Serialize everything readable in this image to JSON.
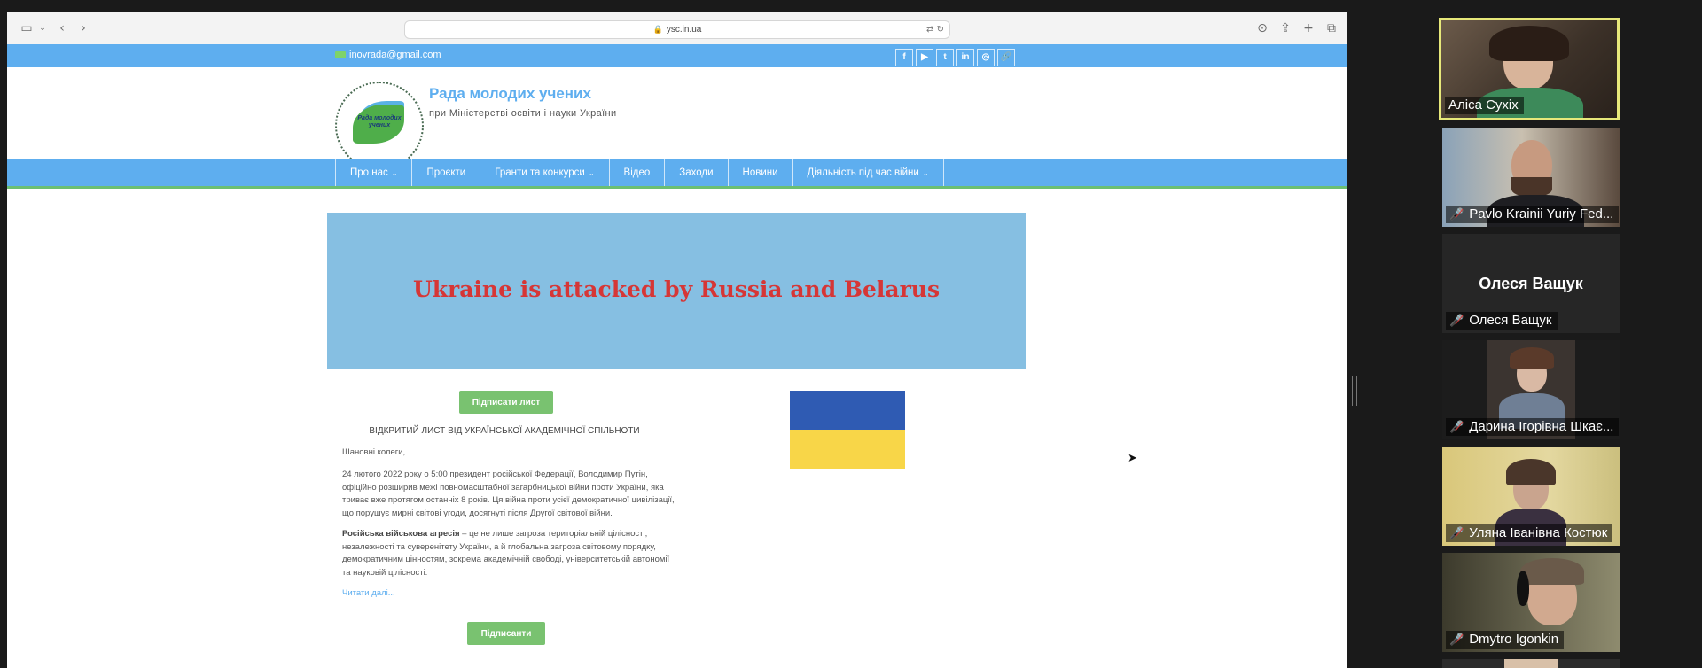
{
  "browser": {
    "url": "ysc.in.ua",
    "icons": [
      "sidebar-icon",
      "chevron-down-icon",
      "back-icon",
      "forward-icon",
      "download-icon",
      "share-icon",
      "new-tab-icon",
      "tabs-icon",
      "translate-icon",
      "reload-icon",
      "lock-icon"
    ]
  },
  "topbar": {
    "email": "inovrada@gmail.com",
    "social": [
      "f",
      "▶",
      "t",
      "in",
      "◎",
      "🔗"
    ]
  },
  "header": {
    "title": "Рада молодих учених",
    "subtitle": "при Міністерстві освіти і науки України",
    "logo_text": "Рада молодих учених"
  },
  "nav": {
    "items": [
      {
        "label": "Про нас",
        "dropdown": true
      },
      {
        "label": "Проєкти",
        "dropdown": false
      },
      {
        "label": "Гранти та конкурси",
        "dropdown": true
      },
      {
        "label": "Відео",
        "dropdown": false
      },
      {
        "label": "Заходи",
        "dropdown": false
      },
      {
        "label": "Новини",
        "dropdown": false
      },
      {
        "label": "Діяльність під час війни",
        "dropdown": true
      }
    ]
  },
  "banner": {
    "text": "Ukraine is attacked by Russia and Belarus"
  },
  "letter": {
    "sign_button": "Підписати лист",
    "title": "ВІДКРИТИЙ ЛИСТ ВІД УКРАЇНСЬКОЇ АКАДЕМІЧНОЇ СПІЛЬНОТИ",
    "greeting": "Шановні колеги,",
    "para1": "24 лютого 2022 року о 5:00 президент російської Федерації, Володимир Путін, офіційно розширив межі повномасштабної загарбницької війни проти України, яка триває вже протягом останніх 8 років. Ця війна проти усієї демократичної цивілізації, що порушує мирні світові угоди, досягнуті після Другої світової війни.",
    "para2_bold": "Російська військова агресія",
    "para2_rest": " – це не лише загроза територіальній цілісності, незалежності та суверенітету України, а й глобальна загроза світовому порядку, демократичним цінностям, зокрема академічній свободі, університетській автономії та науковій цілісності.",
    "read_more": "Читати далі...",
    "signatories_button": "Підписанти"
  },
  "colors": {
    "header_blue": "#5eaeef",
    "banner_blue": "#86bfe2",
    "banner_red": "#d63636",
    "button_green": "#79c270",
    "flag_blue": "#2f5bb3",
    "flag_yellow": "#f8d648",
    "active_speaker": "#e7e87a"
  },
  "participants": [
    {
      "name": "Аліса Сухіх",
      "muted": false,
      "video": true,
      "active": true
    },
    {
      "name": "Pavlo Krainii Yuriy Fed...",
      "muted": true,
      "video": true,
      "active": false
    },
    {
      "name": "Олеся Ващук",
      "muted": true,
      "video": false,
      "active": false,
      "display_name": "Олеся Ващук"
    },
    {
      "name": "Дарина Ігорівна Шкає...",
      "muted": true,
      "video": true,
      "active": false
    },
    {
      "name": "Уляна Іванівна Костюк",
      "muted": true,
      "video": true,
      "active": false
    },
    {
      "name": "Dmytro Igonkin",
      "muted": true,
      "video": true,
      "active": false
    }
  ]
}
